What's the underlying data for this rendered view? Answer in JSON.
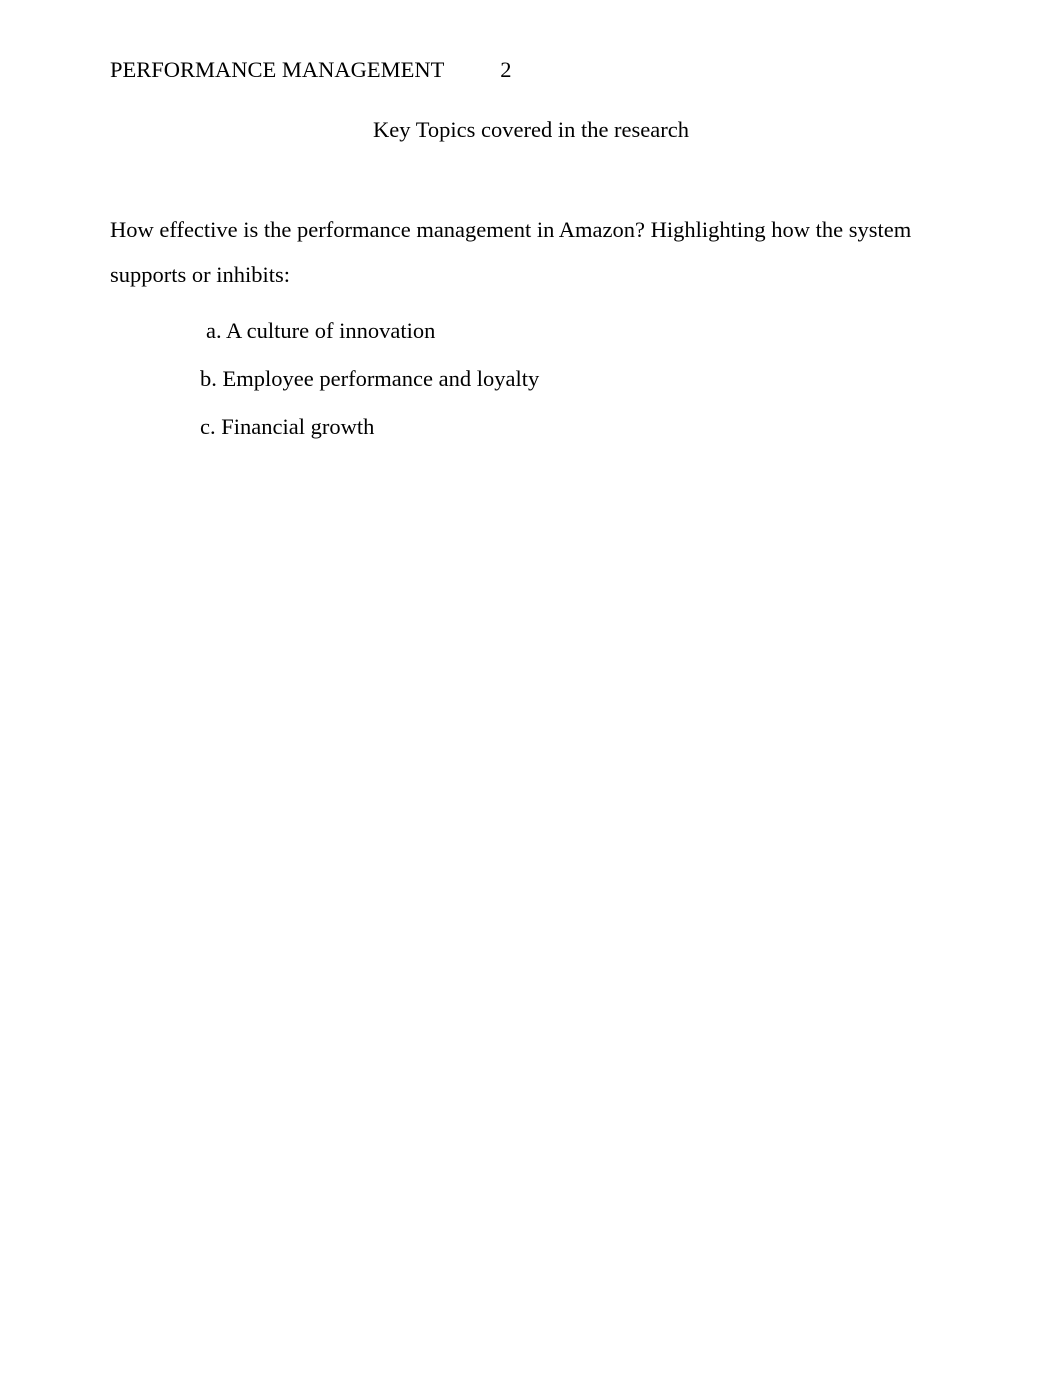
{
  "header": {
    "running_head": "PERFORMANCE MANAGEMENT",
    "page_number": "2"
  },
  "title": "Key Topics covered in the research",
  "body": {
    "line1": "How effective is the performance management in Amazon? Highlighting how the system",
    "line2": "supports or inhibits:"
  },
  "list": {
    "a": " a. A culture of innovation",
    "b": "b. Employee performance and loyalty",
    "c": "c. Financial growth"
  }
}
